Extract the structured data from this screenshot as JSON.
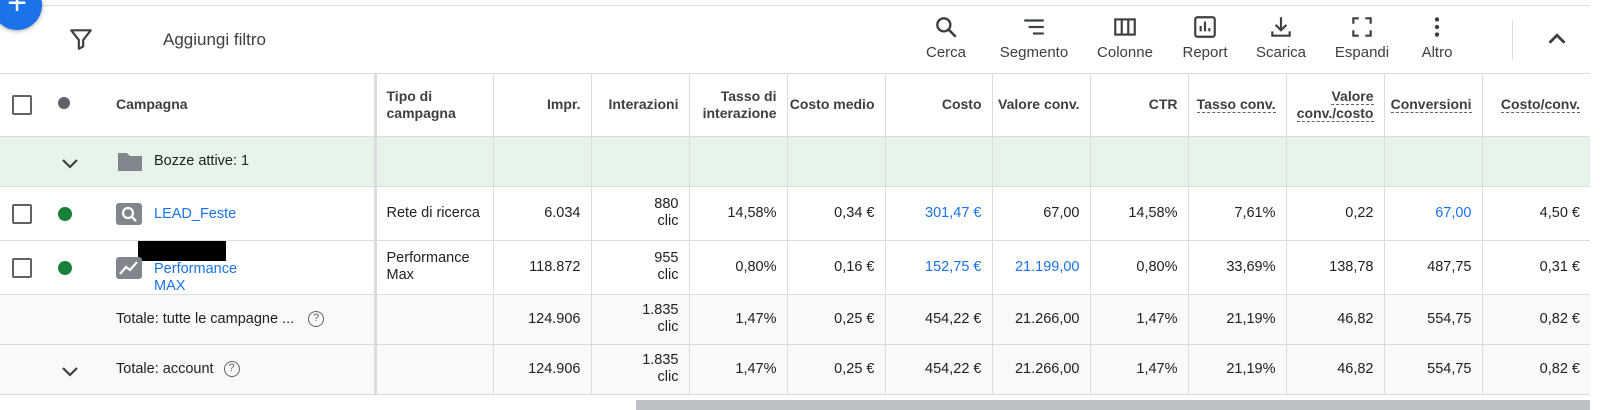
{
  "toolbar": {
    "filter_label": "Aggiungi filtro",
    "tools": [
      {
        "label": "Cerca",
        "icon": "search-icon"
      },
      {
        "label": "Segmento",
        "icon": "segment-icon"
      },
      {
        "label": "Colonne",
        "icon": "columns-icon"
      },
      {
        "label": "Report",
        "icon": "report-icon"
      },
      {
        "label": "Scarica",
        "icon": "download-icon"
      },
      {
        "label": "Espandi",
        "icon": "expand-icon"
      },
      {
        "label": "Altro",
        "icon": "more-icon"
      }
    ]
  },
  "columns": {
    "campaign": "Campagna",
    "type": "Tipo di campagna",
    "impr": "Impr.",
    "interactions": "Interazioni",
    "interaction_rate": "Tasso di interazione",
    "avg_cost": "Costo medio",
    "cost": "Costo",
    "conv_value": "Valore conv.",
    "ctr": "CTR",
    "conv_rate": "Tasso conv.",
    "value_per_cost": "Valore conv./costo",
    "conversions": "Conversioni",
    "cost_per_conv": "Costo/conv."
  },
  "drafts": {
    "label": "Bozze attive: 1"
  },
  "rows": [
    {
      "campaign": "LEAD_Feste",
      "type": "Rete di ricerca",
      "impr": "6.034",
      "interactions_value": "880",
      "interactions_unit": "clic",
      "interaction_rate": "14,58%",
      "avg_cost": "0,34 €",
      "cost": "301,47 €",
      "conv_value": "67,00",
      "ctr": "14,58%",
      "conv_rate": "7,61%",
      "value_per_cost": "0,22",
      "conversions": "67,00",
      "cost_per_conv": "4,50 €"
    },
    {
      "campaign_line1": "Performance",
      "campaign_line2": "MAX",
      "type_line1": "Performance",
      "type_line2": "Max",
      "impr": "118.872",
      "interactions_value": "955",
      "interactions_unit": "clic",
      "interaction_rate": "0,80%",
      "avg_cost": "0,16 €",
      "cost": "152,75 €",
      "conv_value": "21.199,00",
      "ctr": "0,80%",
      "conv_rate": "33,69%",
      "value_per_cost": "138,78",
      "conversions": "487,75",
      "cost_per_conv": "0,31 €"
    }
  ],
  "totals": [
    {
      "label": "Totale: tutte le campagne ...",
      "impr": "124.906",
      "interactions_value": "1.835",
      "interactions_unit": "clic",
      "interaction_rate": "1,47%",
      "avg_cost": "0,25 €",
      "cost": "454,22 €",
      "conv_value": "21.266,00",
      "ctr": "1,47%",
      "conv_rate": "21,19%",
      "value_per_cost": "46,82",
      "conversions": "554,75",
      "cost_per_conv": "0,82 €"
    },
    {
      "label": "Totale: account",
      "impr": "124.906",
      "interactions_value": "1.835",
      "interactions_unit": "clic",
      "interaction_rate": "1,47%",
      "avg_cost": "0,25 €",
      "cost": "454,22 €",
      "conv_value": "21.266,00",
      "ctr": "1,47%",
      "conv_rate": "21,19%",
      "value_per_cost": "46,82",
      "conversions": "554,75",
      "cost_per_conv": "0,82 €"
    }
  ],
  "colors": {
    "accent": "#1a73e8",
    "status_enabled": "#188038",
    "drafts_bg": "#e6f4ea"
  }
}
